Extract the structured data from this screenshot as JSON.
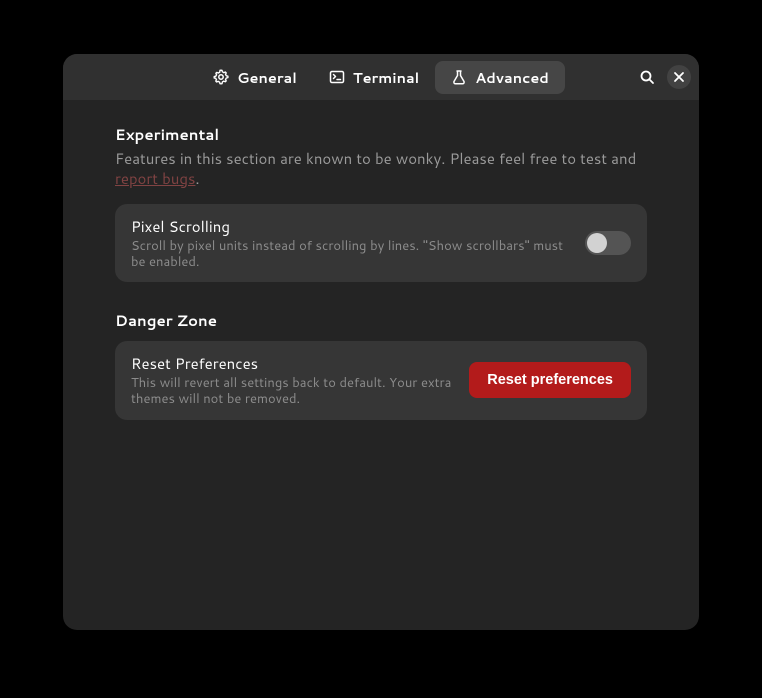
{
  "tabs": {
    "general": "General",
    "terminal": "Terminal",
    "advanced": "Advanced",
    "activeIndex": 2
  },
  "sections": {
    "experimental": {
      "title": "Experimental",
      "desc_pre": "Features in this section are known to be wonky. Please feel free to test and ",
      "desc_link": "report bugs",
      "desc_post": ".",
      "item": {
        "title": "Pixel Scrolling",
        "sub": "Scroll by pixel units instead of scrolling by lines. \"Show scrollbars\" must be enabled."
      }
    },
    "danger": {
      "title": "Danger Zone",
      "item": {
        "title": "Reset Preferences",
        "sub": "This will revert all settings back to default. Your extra themes will not be removed."
      },
      "button": "Reset preferences"
    }
  }
}
